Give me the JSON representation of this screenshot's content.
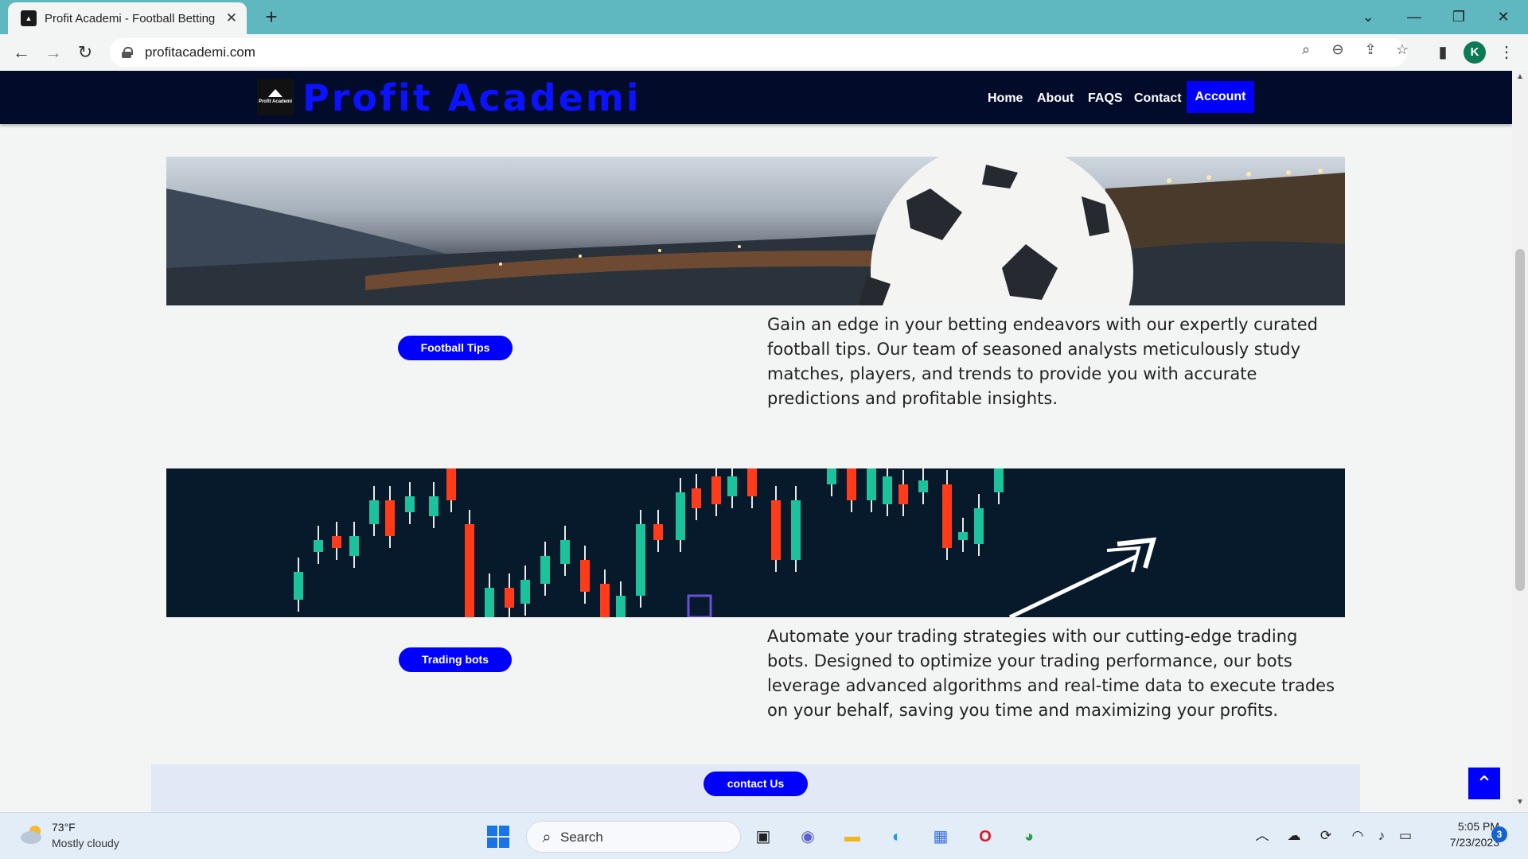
{
  "browser": {
    "tab_title": "Profit Academi - Football Betting",
    "url": "profitacademi.com",
    "profile_initial": "K"
  },
  "site": {
    "logo_text": "Profit Academi",
    "brand_name": "Profit Academi",
    "brand_color": "#0a12ff",
    "nav": [
      "Home",
      "About",
      "FAQS",
      "Contact"
    ],
    "account_label": "Account"
  },
  "sections": [
    {
      "banner": "football-stadium-banner",
      "button_label": "Football Tips",
      "description": "Gain an edge in your betting endeavors with our expertly curated football tips. Our team of seasoned analysts meticulously study matches, players, and trends to provide you with accurate predictions and profitable insights."
    },
    {
      "banner": "trading-candlestick-banner",
      "button_label": "Trading bots",
      "description": "Automate your trading strategies with our cutting-edge trading bots. Designed to optimize your trading performance, our bots leverage advanced algorithms and real-time data to execute trades on your behalf, saving you time and maximizing your profits."
    }
  ],
  "contact_button_label": "contact Us",
  "taskbar": {
    "weather_temp": "73°F",
    "weather_desc": "Mostly cloudy",
    "search_label": "Search",
    "time": "5:05 PM",
    "date": "7/23/2023",
    "notification_count": "3"
  },
  "colors": {
    "header_bg": "#030b2b",
    "accent": "#0000ff",
    "candle_up": "#1bc29c",
    "candle_down": "#ff3b1a"
  }
}
